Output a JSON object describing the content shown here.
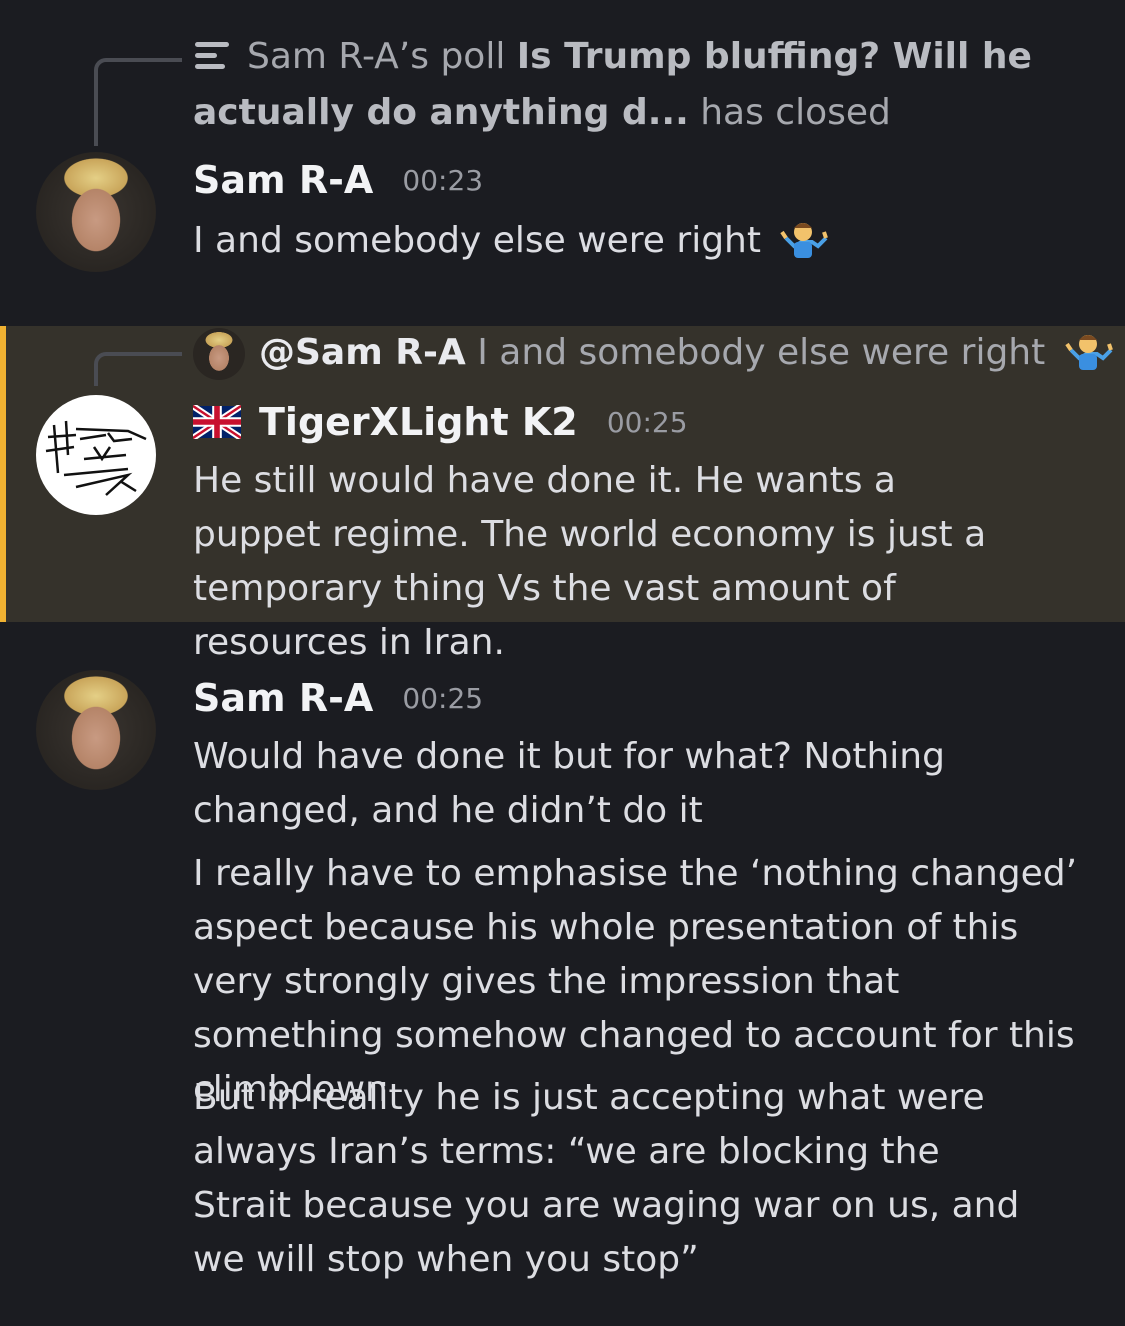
{
  "poll_notice": {
    "prefix": "Sam R-A’s poll",
    "question_line1": "Is Trump bluffing? Will he",
    "question_line2": "actually do anything d...",
    "suffix": "has closed"
  },
  "messages": [
    {
      "author": "Sam R-A",
      "time": "00:23",
      "text": "I and somebody else were right",
      "emoji": "person-shrugging"
    },
    {
      "reply_to": {
        "mention": "@Sam R-A",
        "text": "I and somebody else were right"
      },
      "author": "TigerXLight K2",
      "author_flag": "uk-flag",
      "time": "00:25",
      "text": "He still would have done it. He wants a puppet regime. The world economy is just a temporary thing Vs the vast amount of resources in Iran.",
      "highlighted": true
    },
    {
      "author": "Sam R-A",
      "time": "00:25",
      "paragraphs": [
        "Would have done it but for what? Nothing changed, and he didn’t do it",
        "I really have to emphasise the ‘nothing changed’ aspect because his whole presentation of this very strongly gives the impression that something somehow changed to account for this climbdown",
        "But in reality he is just accepting what were always Iran’s terms: “we are blocking the Strait because you are waging war on us, and we will stop when you stop”"
      ]
    }
  ],
  "colors": {
    "background": "#1b1c21",
    "highlight_bg": "#35322b",
    "highlight_bar": "#f0b232"
  }
}
